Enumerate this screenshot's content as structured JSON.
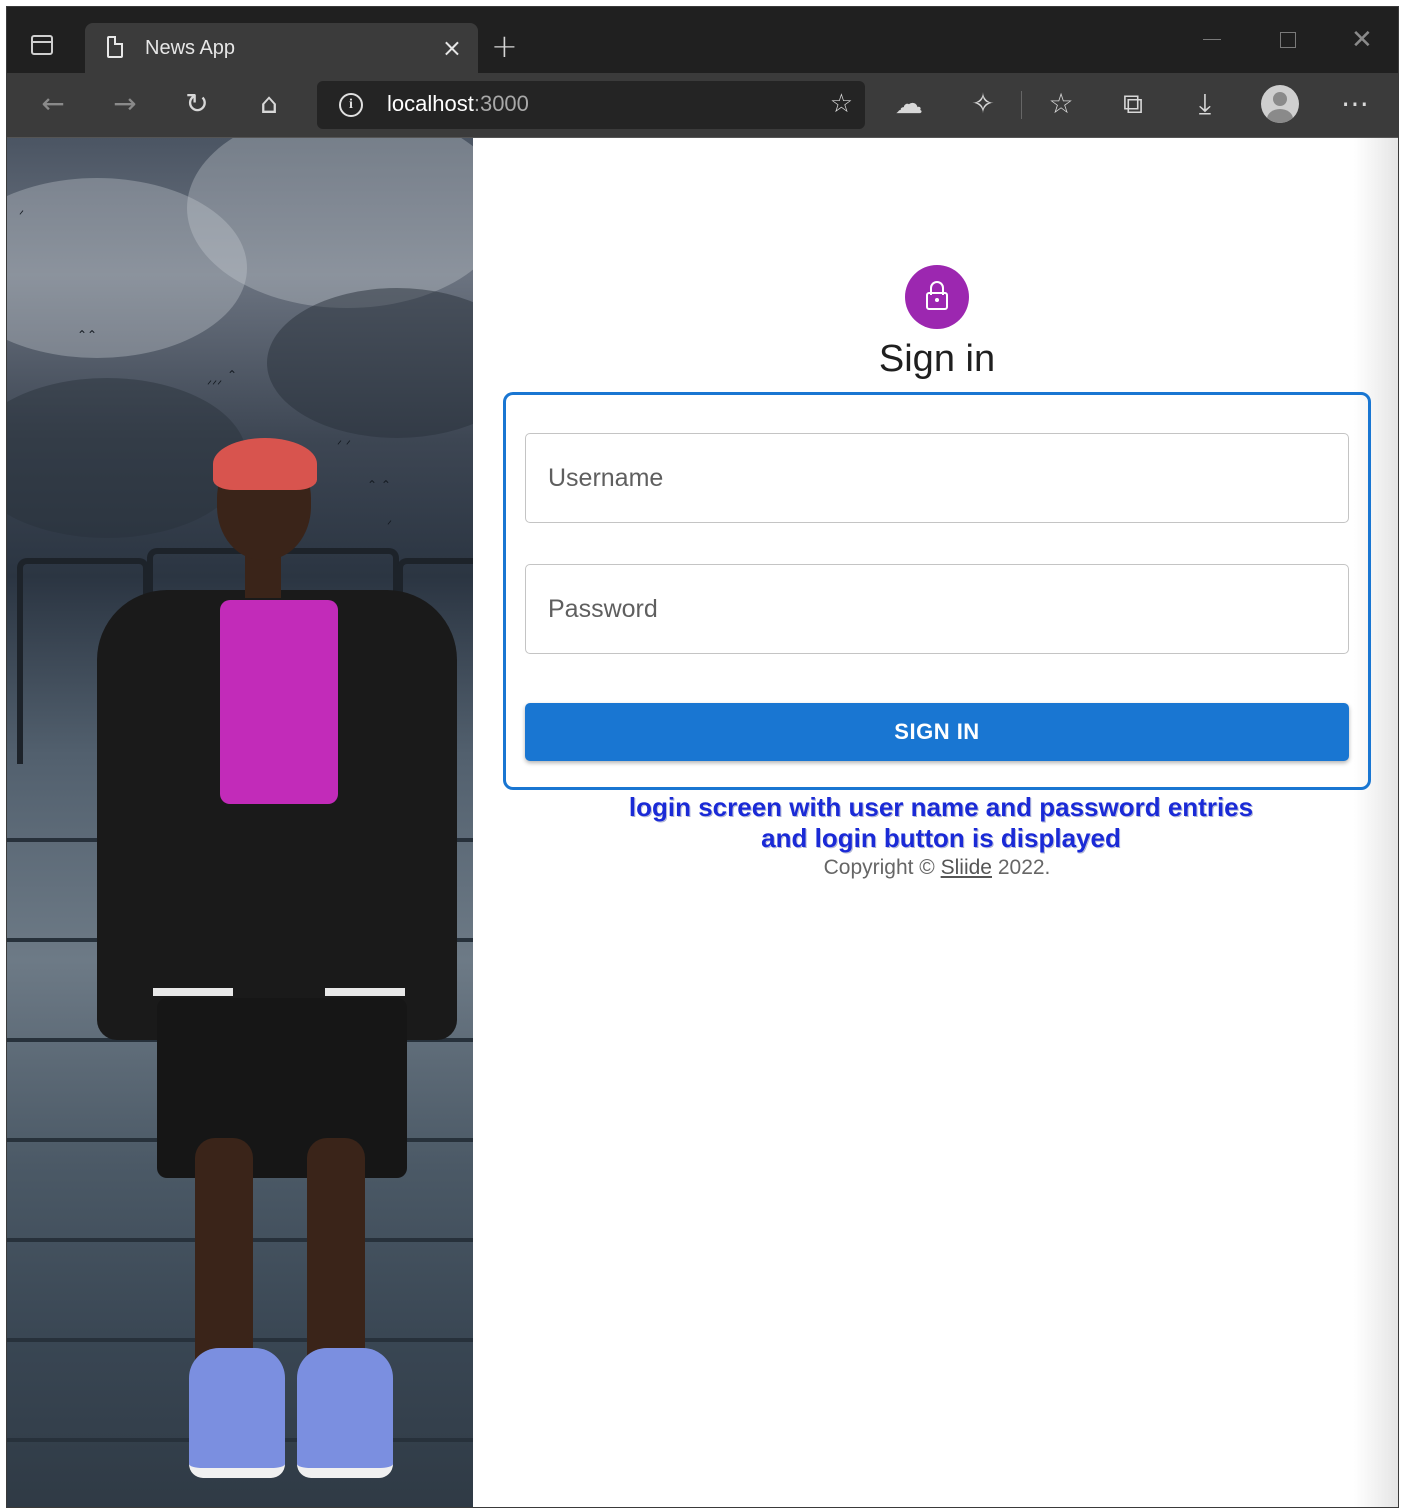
{
  "browser": {
    "tab_title": "News App",
    "tab_close": "×",
    "new_tab": "+",
    "url_host": "localhost",
    "url_port": ":3000"
  },
  "page": {
    "title": "Sign in",
    "username_placeholder": "Username",
    "password_placeholder": "Password",
    "submit_label": "SIGN IN",
    "annotation_line1": "login screen with user name and password entries",
    "annotation_line2": "and login button is displayed",
    "copyright_prefix": "Copyright © ",
    "copyright_link": "Sliide",
    "copyright_suffix": " 2022."
  },
  "colors": {
    "primary": "#1976d2",
    "avatar_purple": "#9c27b0",
    "annotation_blue": "#1a2ad6"
  },
  "icons": [
    "tab-actions-icon",
    "page-icon",
    "close-icon",
    "plus-icon",
    "minimize-icon",
    "maximize-icon",
    "back-icon",
    "forward-icon",
    "refresh-icon",
    "home-icon",
    "info-icon",
    "add-favorite-icon",
    "cloud-icon",
    "extensions-icon",
    "favorites-icon",
    "collections-icon",
    "download-icon",
    "profile-icon",
    "more-icon",
    "lock-icon"
  ]
}
